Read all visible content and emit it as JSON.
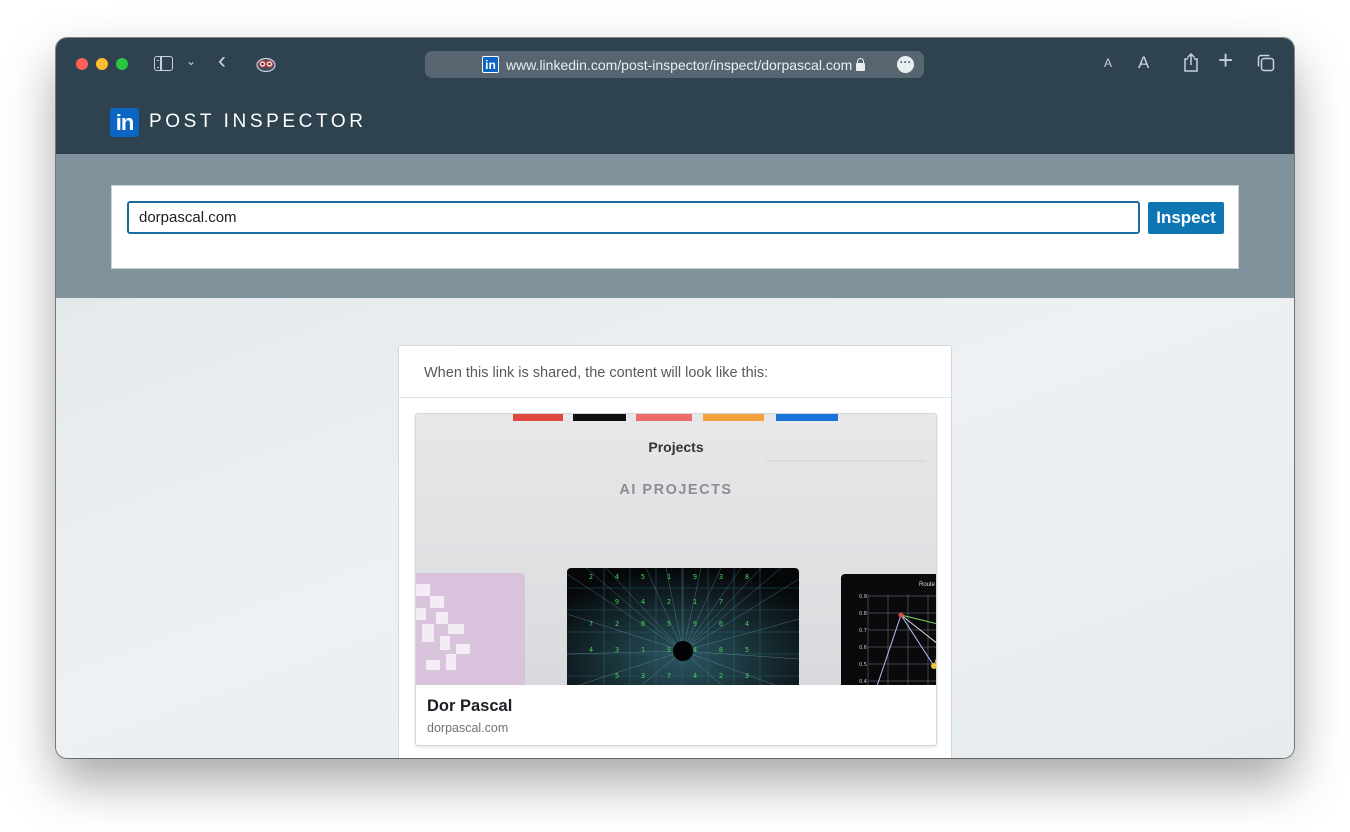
{
  "browser": {
    "url": "www.linkedin.com/post-inspector/inspect/dorpascal.com",
    "reader_small_label": "A",
    "reader_large_label": "A",
    "favicon_label": "in"
  },
  "app": {
    "logo_text": "in",
    "title": "POST INSPECTOR"
  },
  "search": {
    "value": "dorpascal.com",
    "button_label": "Inspect"
  },
  "preview": {
    "caption": "When this link is shared, the content will look like this:",
    "card": {
      "title": "Dor Pascal",
      "domain": "dorpascal.com",
      "image": {
        "heading": "Projects",
        "subheading": "AI PROJECTS",
        "grid_numbers": [
          [
            "2",
            "4",
            "5",
            "1",
            "9",
            "3",
            "8"
          ],
          [
            "9",
            "4",
            "2",
            "1",
            "7"
          ],
          [
            "7",
            "2",
            "8",
            "5",
            "9",
            "6",
            "4"
          ],
          [
            "4",
            "3",
            "1",
            "9",
            "4",
            "8",
            "5"
          ],
          [
            "5",
            "3",
            "7",
            "4",
            "2",
            "3"
          ]
        ],
        "chart_title": "Route",
        "chart_ticks": [
          "0.9",
          "0.8",
          "0.7",
          "0.6",
          "0.5",
          "0.4"
        ]
      }
    }
  },
  "colors": {
    "titlebar": "#2f4250",
    "search_band": "#80939d",
    "linkedin_blue": "#0a66c2",
    "button_blue": "#0d76b3"
  }
}
